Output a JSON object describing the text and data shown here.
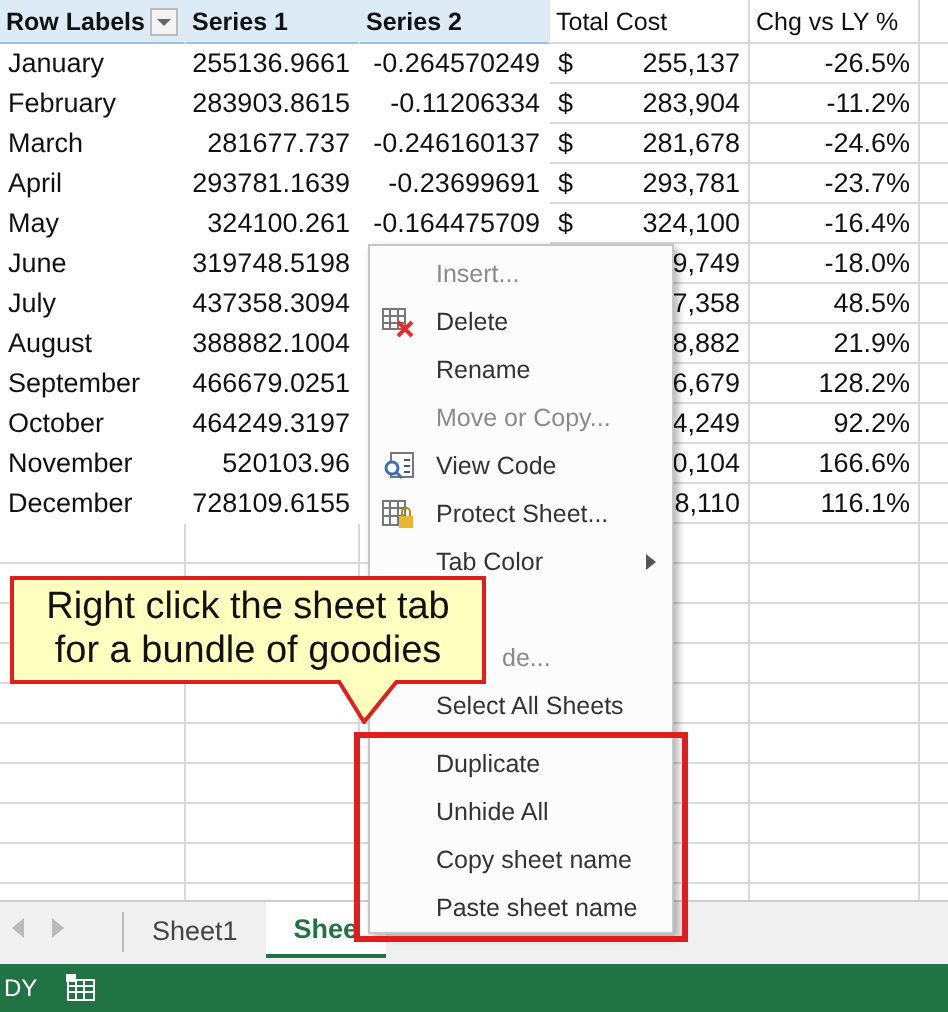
{
  "table": {
    "columns": [
      {
        "label": "Row Labels",
        "kind": "pivot",
        "filter": true
      },
      {
        "label": "Series 1",
        "kind": "pivot"
      },
      {
        "label": "Series 2",
        "kind": "pivot"
      },
      {
        "label": "Total Cost",
        "kind": "plain"
      },
      {
        "label": "Chg vs LY %",
        "kind": "plain"
      }
    ],
    "rows": [
      {
        "label": "January",
        "series_1": "255136.9661",
        "series_2": "-0.264570249",
        "currency": "$",
        "total_cost": "255,137",
        "change": "-26.5%"
      },
      {
        "label": "February",
        "series_1": "283903.8615",
        "series_2": "-0.11206334",
        "currency": "$",
        "total_cost": "283,904",
        "change": "-11.2%"
      },
      {
        "label": "March",
        "series_1": "281677.737",
        "series_2": "-0.246160137",
        "currency": "$",
        "total_cost": "281,678",
        "change": "-24.6%"
      },
      {
        "label": "April",
        "series_1": "293781.1639",
        "series_2": "-0.23699691",
        "currency": "$",
        "total_cost": "293,781",
        "change": "-23.7%"
      },
      {
        "label": "May",
        "series_1": "324100.261",
        "series_2": "-0.164475709",
        "currency": "$",
        "total_cost": "324,100",
        "change": "-16.4%"
      },
      {
        "label": "June",
        "series_1": "319748.5198",
        "total_cost": "9,749",
        "change": "-18.0%"
      },
      {
        "label": "July",
        "series_1": "437358.3094",
        "total_cost": "7,358",
        "change": "48.5%"
      },
      {
        "label": "August",
        "series_1": "388882.1004",
        "total_cost": "8,882",
        "change": "21.9%"
      },
      {
        "label": "September",
        "series_1": "466679.0251",
        "total_cost": "6,679",
        "change": "128.2%"
      },
      {
        "label": "October",
        "series_1": "464249.3197",
        "total_cost": "4,249",
        "change": "92.2%"
      },
      {
        "label": "November",
        "series_1": "520103.96",
        "total_cost": "0,104",
        "change": "166.6%"
      },
      {
        "label": "December",
        "series_1": "728109.6155",
        "total_cost": "8,110",
        "change": "116.1%"
      }
    ]
  },
  "sheet_tabs": [
    {
      "label": "Sheet1",
      "selected": false
    },
    {
      "label": "Shee",
      "selected": true
    }
  ],
  "status_bar": {
    "text": "DY"
  },
  "context_menu": {
    "items": [
      {
        "label": "Insert...",
        "kind": "item",
        "disabled": true
      },
      {
        "label": "Delete",
        "kind": "item",
        "disabled": false
      },
      {
        "label": "Rename",
        "kind": "item",
        "disabled": false
      },
      {
        "label": "Move or Copy...",
        "kind": "item",
        "disabled": true
      },
      {
        "label": "View Code",
        "kind": "item",
        "disabled": false
      },
      {
        "label": "Protect Sheet...",
        "kind": "item",
        "disabled": false
      },
      {
        "label": "Tab Color",
        "kind": "submenu",
        "disabled": false
      },
      {
        "label": "de...",
        "kind": "partial",
        "disabled": true
      },
      {
        "label": "Select All Sheets",
        "kind": "item",
        "disabled": false
      },
      {
        "kind": "separator"
      },
      {
        "label": "Duplicate",
        "kind": "item",
        "disabled": false
      },
      {
        "label": "Unhide All",
        "kind": "item",
        "disabled": false
      },
      {
        "label": "Copy sheet name",
        "kind": "item",
        "disabled": false
      },
      {
        "label": "Paste sheet name",
        "kind": "item",
        "disabled": false
      }
    ]
  },
  "callout": {
    "text": "Right click the sheet tab\nfor a bundle of goodies"
  }
}
